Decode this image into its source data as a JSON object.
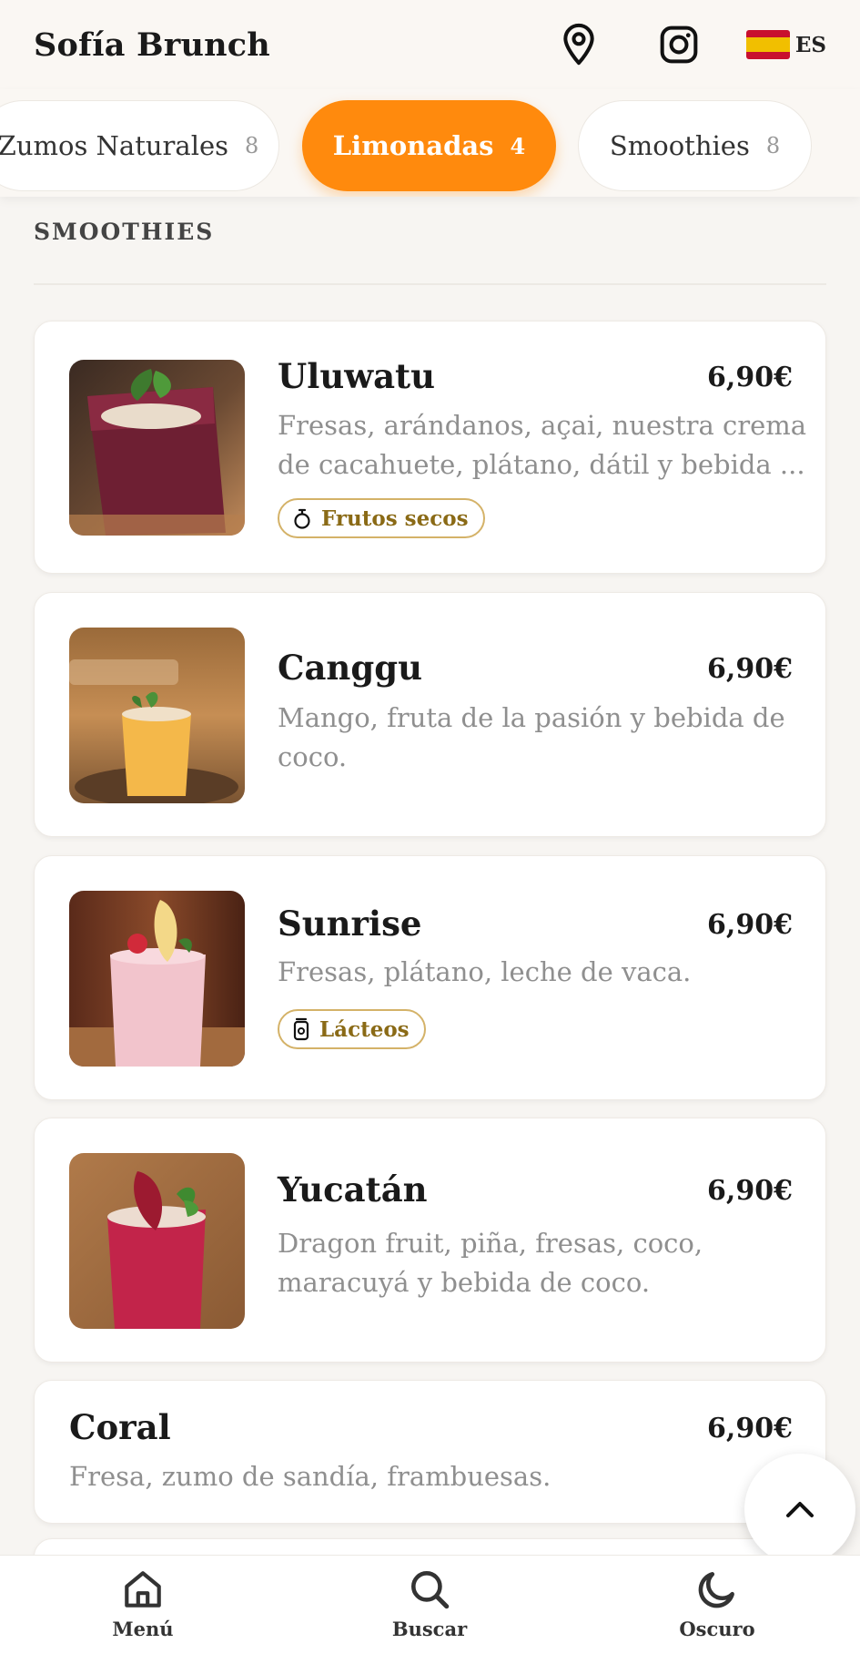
{
  "header": {
    "brand": "Sofía Brunch",
    "language_code": "ES"
  },
  "tabs": [
    {
      "label": "Zumos Naturales",
      "count": "8",
      "active": false
    },
    {
      "label": "Limonadas",
      "count": "4",
      "active": true
    },
    {
      "label": "Smoothies",
      "count": "8",
      "active": false
    }
  ],
  "section": {
    "title": "SMOOTHIES"
  },
  "items": [
    {
      "name": "Uluwatu",
      "price": "6,90€",
      "description_line1": "Fresas, arándanos, açai, nuestra crema",
      "description_line2": "de cacahuete, plátano, dátil y bebida ...",
      "badge": "Frutos secos",
      "badge_icon": "nut-icon"
    },
    {
      "name": "Canggu",
      "price": "6,90€",
      "description_line1": "Mango, fruta de la pasión y bebida de",
      "description_line2": "coco."
    },
    {
      "name": "Sunrise",
      "price": "6,90€",
      "description_line1": "Fresas, plátano, leche de vaca.",
      "badge": "Lácteos",
      "badge_icon": "milk-icon"
    },
    {
      "name": "Yucatán",
      "price": "6,90€",
      "description_line1": "Dragon fruit, piña, fresas, coco,",
      "description_line2": "maracuyá y bebida de coco."
    },
    {
      "name": "Coral",
      "price": "6,90€",
      "description_line1": "Fresa, zumo de sandía, frambuesas."
    }
  ],
  "bottom_nav": {
    "menu": "Menú",
    "search": "Buscar",
    "dark": "Oscuro"
  },
  "colors": {
    "accent": "#ff8a0d",
    "badge_border": "#d4b268",
    "badge_text": "#8a6a16"
  }
}
